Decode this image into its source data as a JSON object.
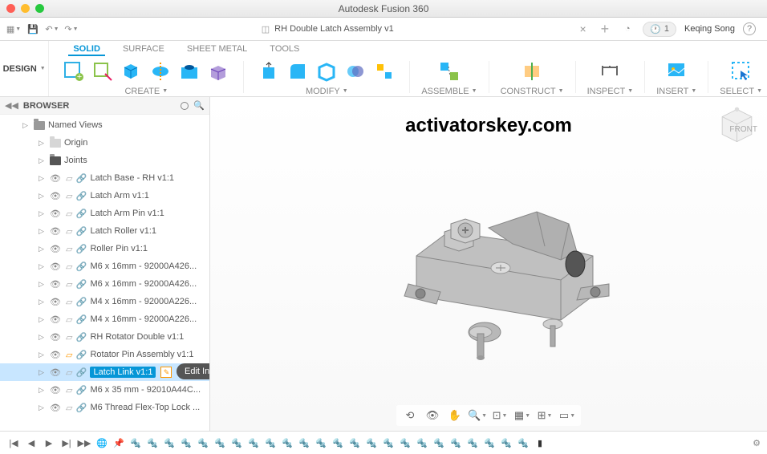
{
  "app": {
    "title": "Autodesk Fusion 360"
  },
  "document": {
    "title": "RH Double Latch Assembly v1"
  },
  "user": {
    "name": "Keqing Song"
  },
  "notifications": {
    "count": "1"
  },
  "workspace": {
    "label": "DESIGN"
  },
  "ribbon": {
    "tabs": [
      "SOLID",
      "SURFACE",
      "SHEET METAL",
      "TOOLS"
    ],
    "groups": {
      "create": "CREATE",
      "modify": "MODIFY",
      "assemble": "ASSEMBLE",
      "construct": "CONSTRUCT",
      "inspect": "INSPECT",
      "insert": "INSERT",
      "select": "SELECT"
    }
  },
  "browser": {
    "title": "BROWSER",
    "items": [
      {
        "label": "Named Views",
        "type": "folder",
        "indent": 1
      },
      {
        "label": "Origin",
        "type": "folder-dim",
        "indent": 2
      },
      {
        "label": "Joints",
        "type": "folder-dark",
        "indent": 2
      },
      {
        "label": "Latch Base - RH v1:1",
        "type": "link",
        "indent": 2
      },
      {
        "label": "Latch Arm v1:1",
        "type": "link",
        "indent": 2
      },
      {
        "label": "Latch Arm Pin v1:1",
        "type": "link",
        "indent": 2
      },
      {
        "label": "Latch Roller v1:1",
        "type": "link",
        "indent": 2
      },
      {
        "label": "Roller Pin v1:1",
        "type": "link",
        "indent": 2
      },
      {
        "label": "M6 x 16mm - 92000A426...",
        "type": "link",
        "indent": 2
      },
      {
        "label": "M6 x 16mm - 92000A426...",
        "type": "link",
        "indent": 2
      },
      {
        "label": "M4 x 16mm - 92000A226...",
        "type": "link",
        "indent": 2
      },
      {
        "label": "M4 x 16mm - 92000A226...",
        "type": "link",
        "indent": 2
      },
      {
        "label": "RH Rotator Double v1:1",
        "type": "link",
        "indent": 2
      },
      {
        "label": "Rotator Pin Assembly v1:1",
        "type": "link-warn",
        "indent": 2
      },
      {
        "label": "Latch Link v1:1",
        "type": "link",
        "indent": 2,
        "selected": true,
        "edit": true
      },
      {
        "label": "M6 x 35 mm - 92010A44C...",
        "type": "link",
        "indent": 2
      },
      {
        "label": "M6 Thread Flex-Top Lock ...",
        "type": "link",
        "indent": 2
      }
    ],
    "tooltip": "Edit In Place"
  },
  "watermark": "activatorskey.com",
  "timeline": {
    "item_count": 26
  }
}
